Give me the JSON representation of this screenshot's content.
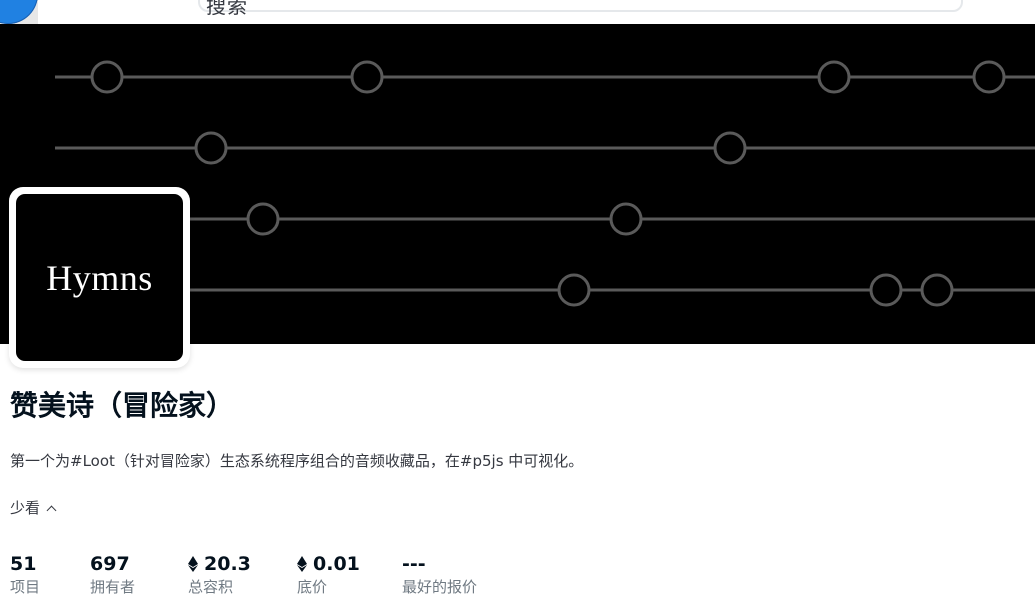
{
  "header": {
    "search_placeholder": "搜索"
  },
  "banner": {
    "background": "#000000",
    "line_color": "#5a5a5a"
  },
  "collection": {
    "avatar_text": "Hymns",
    "title": "赞美诗（冒险家）",
    "description": "第一个为#Loot（针对冒险家）生态系统程序组合的音频收藏品，在#p5js 中可视化。",
    "see_less_label": "少看"
  },
  "stats": [
    {
      "value": "51",
      "label": "项目",
      "icon": ""
    },
    {
      "value": "697",
      "label": "拥有者",
      "icon": ""
    },
    {
      "value": "20.3",
      "label": "总容积",
      "icon": "eth-icon"
    },
    {
      "value": "0.01",
      "label": "底价",
      "icon": "eth-icon"
    },
    {
      "value": "---",
      "label": "最好的报价",
      "icon": ""
    }
  ],
  "colors": {
    "brand_blue": "#2081e2",
    "text_primary": "#04111d",
    "text_secondary": "#707a83"
  }
}
